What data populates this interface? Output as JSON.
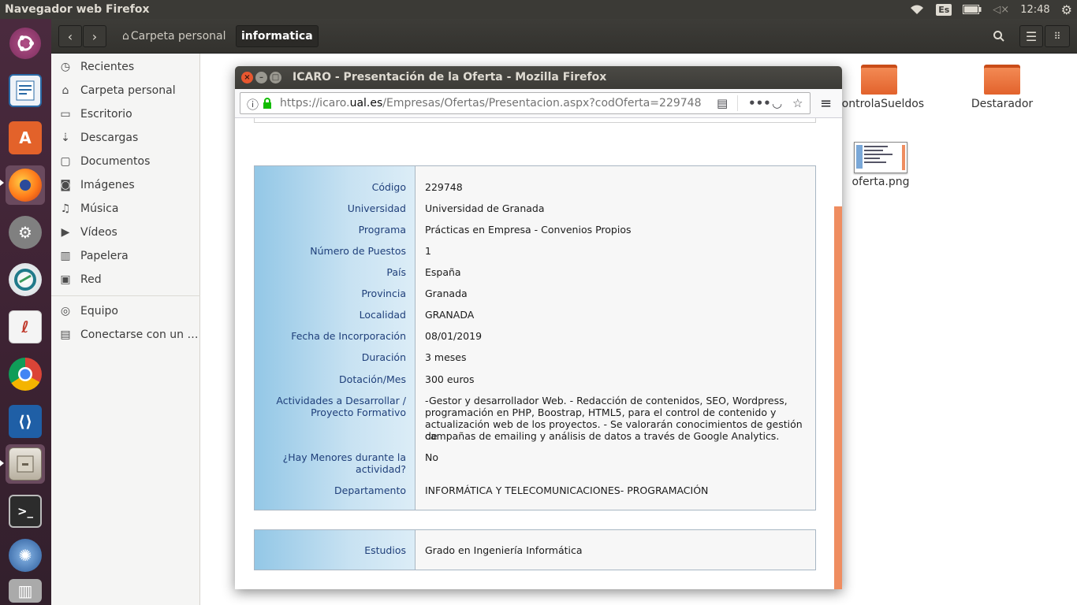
{
  "panel": {
    "app_title": "Navegador web Firefox",
    "keyboard": "Es",
    "clock": "12:48"
  },
  "launcher": {
    "items": [
      {
        "name": "ubuntu-dash",
        "color": "#8a3b6a"
      },
      {
        "name": "libreoffice-writer",
        "color": "#2a6aa6"
      },
      {
        "name": "ubuntu-software",
        "color": "#e06a2b"
      },
      {
        "name": "firefox",
        "color": "#e66000"
      },
      {
        "name": "system-settings",
        "color": "#7a7a7a"
      },
      {
        "name": "vpn-client",
        "color": "#2a7a8a"
      },
      {
        "name": "pdf-reader",
        "color": "#f2f2f2"
      },
      {
        "name": "chrome",
        "color": "#4285f4"
      },
      {
        "name": "vscode",
        "color": "#1f5fa6"
      },
      {
        "name": "files",
        "color": "#8a8070"
      },
      {
        "name": "terminal",
        "color": "#2c2c2c"
      },
      {
        "name": "shutter",
        "color": "#3a6ab0"
      },
      {
        "name": "trash",
        "color": "#9a9a9a"
      }
    ]
  },
  "files": {
    "breadcrumb_home": "Carpeta personal",
    "breadcrumb_current": "informatica",
    "sidebar": [
      {
        "label": "Recientes",
        "icon": "clock-icon",
        "glyph": "◷"
      },
      {
        "label": "Carpeta personal",
        "icon": "home-icon",
        "glyph": "⌂"
      },
      {
        "label": "Escritorio",
        "icon": "desktop-icon",
        "glyph": "▭"
      },
      {
        "label": "Descargas",
        "icon": "download-icon",
        "glyph": "⇣"
      },
      {
        "label": "Documentos",
        "icon": "document-icon",
        "glyph": "▢"
      },
      {
        "label": "Imágenes",
        "icon": "camera-icon",
        "glyph": "◙"
      },
      {
        "label": "Música",
        "icon": "music-icon",
        "glyph": "♫"
      },
      {
        "label": "Vídeos",
        "icon": "video-icon",
        "glyph": "▶"
      },
      {
        "label": "Papelera",
        "icon": "trash-icon",
        "glyph": "▥"
      },
      {
        "label": "Red",
        "icon": "network-icon",
        "glyph": "▣"
      },
      {
        "label": "Equipo",
        "icon": "computer-icon",
        "glyph": "◎"
      },
      {
        "label": "Conectarse con un …",
        "icon": "connect-server-icon",
        "glyph": "▤"
      }
    ],
    "items": [
      {
        "label": "ControlaSueldos",
        "type": "folder"
      },
      {
        "label": "Destarador",
        "type": "folder"
      },
      {
        "label": "oferta.png",
        "type": "image"
      }
    ]
  },
  "firefox": {
    "window_title": "ICARO - Presentación de la Oferta - Mozilla Firefox",
    "url_prefix": "https://icaro.",
    "url_host": "ual.es",
    "url_path": "/Empresas/Ofertas/Presentacion.aspx?codOferta=229748"
  },
  "offer": {
    "rows": [
      {
        "label": "Código",
        "value": "229748"
      },
      {
        "label": "Universidad",
        "value": "Universidad de Granada"
      },
      {
        "label": "Programa",
        "value": "Prácticas en Empresa - Convenios Propios"
      },
      {
        "label": "Número de Puestos",
        "value": "1"
      },
      {
        "label": "País",
        "value": "España"
      },
      {
        "label": "Provincia",
        "value": "Granada"
      },
      {
        "label": "Localidad",
        "value": "GRANADA"
      },
      {
        "label": "Fecha de Incorporación",
        "value": "08/01/2019"
      },
      {
        "label": "Duración",
        "value": "3 meses"
      },
      {
        "label": "Dotación/Mes",
        "value": "300 euros"
      },
      {
        "label_1": "Actividades a Desarrollar /",
        "label_2": "Proyecto Formativo",
        "value_1": "-Gestor y desarrollador Web. - Redacción de contenidos, SEO, Wordpress,",
        "value_2": "programación en PHP, Boostrap, HTML5, para el control de contenido y",
        "value_3": "actualización web de los proyectos. - Se valorarán conocimientos de gestión de",
        "value_4": "campañas de emailing y análisis de datos a través de Google Analytics."
      },
      {
        "label_1": "¿Hay Menores durante la",
        "label_2": "actividad?",
        "value": "No"
      },
      {
        "label": "Departamento",
        "value": "INFORMÁTICA Y TELECOMUNICACIONES- PROGRAMACIÓN"
      }
    ],
    "studies": {
      "label": "Estudios",
      "value": "Grado en Ingeniería Informática"
    }
  }
}
